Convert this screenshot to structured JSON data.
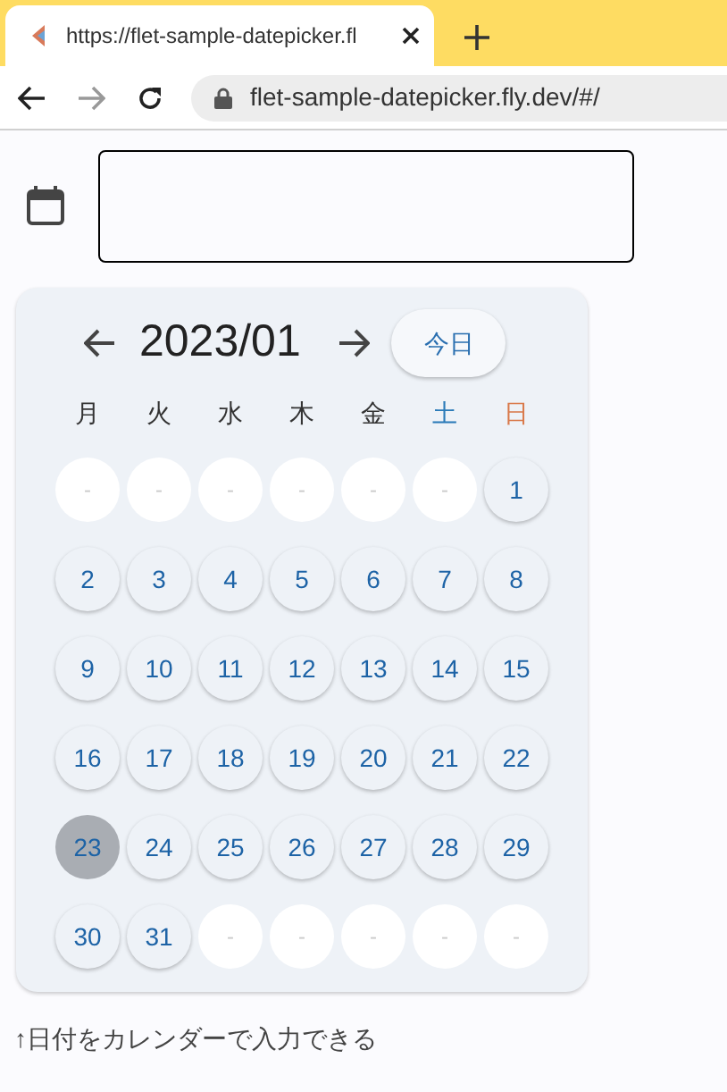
{
  "browser": {
    "tab_title": "https://flet-sample-datepicker.fl",
    "address": "flet-sample-datepicker.fly.dev/#/"
  },
  "calendar": {
    "title": "2023/01",
    "today_button": "今日",
    "weekdays": [
      {
        "label": "月",
        "kind": "weekday"
      },
      {
        "label": "火",
        "kind": "weekday"
      },
      {
        "label": "水",
        "kind": "weekday"
      },
      {
        "label": "木",
        "kind": "weekday"
      },
      {
        "label": "金",
        "kind": "weekday"
      },
      {
        "label": "土",
        "kind": "saturday"
      },
      {
        "label": "日",
        "kind": "sunday"
      }
    ],
    "days": [
      {
        "label": "-",
        "kind": "empty",
        "selected": false
      },
      {
        "label": "-",
        "kind": "empty",
        "selected": false
      },
      {
        "label": "-",
        "kind": "empty",
        "selected": false
      },
      {
        "label": "-",
        "kind": "empty",
        "selected": false
      },
      {
        "label": "-",
        "kind": "empty",
        "selected": false
      },
      {
        "label": "-",
        "kind": "empty",
        "selected": false
      },
      {
        "label": "1",
        "kind": "day",
        "selected": false
      },
      {
        "label": "2",
        "kind": "day",
        "selected": false
      },
      {
        "label": "3",
        "kind": "day",
        "selected": false
      },
      {
        "label": "4",
        "kind": "day",
        "selected": false
      },
      {
        "label": "5",
        "kind": "day",
        "selected": false
      },
      {
        "label": "6",
        "kind": "day",
        "selected": false
      },
      {
        "label": "7",
        "kind": "day",
        "selected": false
      },
      {
        "label": "8",
        "kind": "day",
        "selected": false
      },
      {
        "label": "9",
        "kind": "day",
        "selected": false
      },
      {
        "label": "10",
        "kind": "day",
        "selected": false
      },
      {
        "label": "11",
        "kind": "day",
        "selected": false
      },
      {
        "label": "12",
        "kind": "day",
        "selected": false
      },
      {
        "label": "13",
        "kind": "day",
        "selected": false
      },
      {
        "label": "14",
        "kind": "day",
        "selected": false
      },
      {
        "label": "15",
        "kind": "day",
        "selected": false
      },
      {
        "label": "16",
        "kind": "day",
        "selected": false
      },
      {
        "label": "17",
        "kind": "day",
        "selected": false
      },
      {
        "label": "18",
        "kind": "day",
        "selected": false
      },
      {
        "label": "19",
        "kind": "day",
        "selected": false
      },
      {
        "label": "20",
        "kind": "day",
        "selected": false
      },
      {
        "label": "21",
        "kind": "day",
        "selected": false
      },
      {
        "label": "22",
        "kind": "day",
        "selected": false
      },
      {
        "label": "23",
        "kind": "day",
        "selected": true
      },
      {
        "label": "24",
        "kind": "day",
        "selected": false
      },
      {
        "label": "25",
        "kind": "day",
        "selected": false
      },
      {
        "label": "26",
        "kind": "day",
        "selected": false
      },
      {
        "label": "27",
        "kind": "day",
        "selected": false
      },
      {
        "label": "28",
        "kind": "day",
        "selected": false
      },
      {
        "label": "29",
        "kind": "day",
        "selected": false
      },
      {
        "label": "30",
        "kind": "day",
        "selected": false
      },
      {
        "label": "31",
        "kind": "day",
        "selected": false
      },
      {
        "label": "-",
        "kind": "empty",
        "selected": false
      },
      {
        "label": "-",
        "kind": "empty",
        "selected": false
      },
      {
        "label": "-",
        "kind": "empty",
        "selected": false
      },
      {
        "label": "-",
        "kind": "empty",
        "selected": false
      },
      {
        "label": "-",
        "kind": "empty",
        "selected": false
      }
    ]
  },
  "caption": "↑日付をカレンダーで入力できる"
}
